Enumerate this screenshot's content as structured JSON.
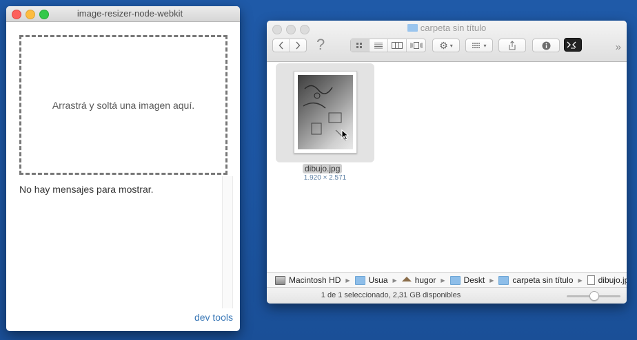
{
  "app_window": {
    "title": "image-resizer-node-webkit",
    "dropzone_text": "Arrastrá y soltá una imagen aquí.",
    "messages_text": "No hay mensajes para mostrar.",
    "dev_tools_link": "dev tools"
  },
  "finder": {
    "title": "carpeta sin título",
    "toolbar": {
      "back_icon": "chevron-left-icon",
      "forward_icon": "chevron-right-icon",
      "view_modes": [
        "icon-view-icon",
        "list-view-icon",
        "column-view-icon",
        "coverflow-view-icon"
      ],
      "selected_view": "icon-view-icon",
      "overflow_glyph": "»"
    },
    "file": {
      "name": "dibujo.jpg",
      "dimensions": "1.920 × 2.571"
    },
    "path": [
      {
        "label": "Macintosh HD",
        "icon": "hard-drive-icon"
      },
      {
        "label": "Usua",
        "icon": "folder-icon"
      },
      {
        "label": "hugor",
        "icon": "home-icon"
      },
      {
        "label": "Deskt",
        "icon": "folder-icon"
      },
      {
        "label": "carpeta sin título",
        "icon": "folder-icon"
      },
      {
        "label": "dibujo.jpg",
        "icon": "document-icon"
      }
    ],
    "status_text": "1 de 1 seleccionado, 2,31 GB disponibles",
    "icon_size_slider": 0.5
  }
}
